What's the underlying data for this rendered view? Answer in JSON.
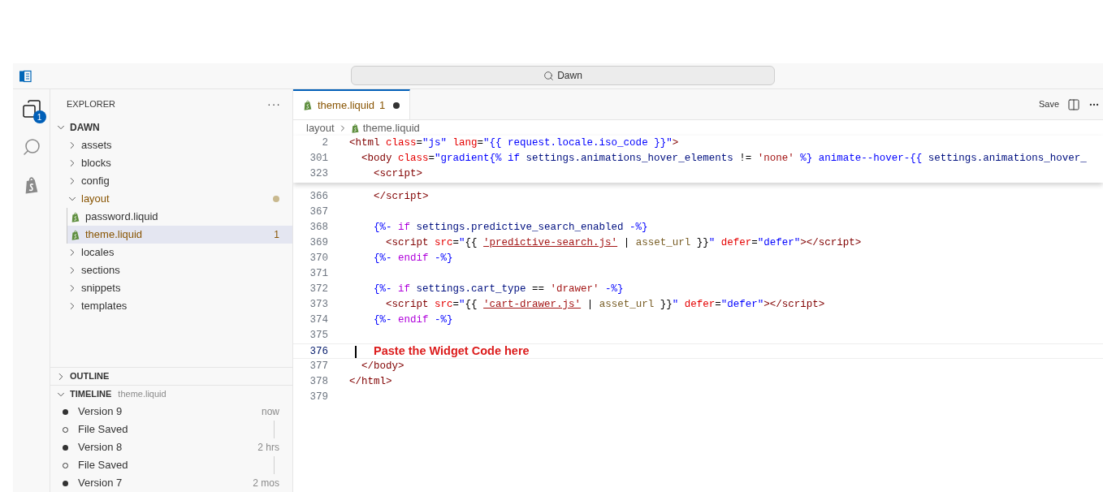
{
  "title_bar": {
    "search": "Dawn"
  },
  "activity_bar": [
    {
      "kind": "explorer",
      "badge": "1",
      "selected": true
    },
    {
      "kind": "search",
      "selected": false
    },
    {
      "kind": "shopify",
      "selected": false
    }
  ],
  "explorer": {
    "title": "EXPLORER",
    "more": "···",
    "root": {
      "label": "DAWN",
      "expanded": true,
      "children": [
        {
          "label": "assets",
          "folder": true,
          "expanded": false,
          "modified": false,
          "selected": false
        },
        {
          "label": "blocks",
          "folder": true,
          "expanded": false,
          "modified": false,
          "selected": false
        },
        {
          "label": "config",
          "folder": true,
          "expanded": false,
          "modified": false,
          "selected": false
        },
        {
          "label": "layout",
          "folder": true,
          "expanded": true,
          "modified": true,
          "selected": false,
          "children": [
            {
              "label": "password.liquid",
              "folder": false,
              "modified": false,
              "selected": false
            },
            {
              "label": "theme.liquid",
              "folder": false,
              "modified": true,
              "selected": true,
              "problems": "1"
            }
          ]
        },
        {
          "label": "locales",
          "folder": true,
          "expanded": false,
          "modified": false,
          "selected": false
        },
        {
          "label": "sections",
          "folder": true,
          "expanded": false,
          "modified": false,
          "selected": false
        },
        {
          "label": "snippets",
          "folder": true,
          "expanded": false,
          "modified": false,
          "selected": false
        },
        {
          "label": "templates",
          "folder": true,
          "expanded": false,
          "modified": false,
          "selected": false
        }
      ]
    }
  },
  "outline": {
    "label": "OUTLINE",
    "expanded": false
  },
  "timeline": {
    "label": "TIMELINE",
    "file": "theme.liquid",
    "expanded": true,
    "items": [
      {
        "kind": "version",
        "label": "Version 9",
        "time": "now"
      },
      {
        "kind": "saved",
        "label": "File Saved"
      },
      {
        "kind": "version",
        "label": "Version 8",
        "time": "2 hrs"
      },
      {
        "kind": "saved",
        "label": "File Saved"
      },
      {
        "kind": "version",
        "label": "Version 7",
        "time": "2 mos"
      }
    ]
  },
  "tabs": [
    {
      "label": "theme.liquid",
      "problems": "1",
      "dirty": true,
      "selected": true
    }
  ],
  "editor_actions": {
    "save": "Save"
  },
  "breadcrumb": [
    "layout",
    "theme.liquid"
  ],
  "sticky_lines": [
    {
      "number": "2",
      "tokens": [
        {
          "kind": "tag",
          "t": "<html"
        },
        {
          "kind": "attr",
          "t": " class"
        },
        {
          "kind": "plain",
          "t": "="
        },
        {
          "kind": "str",
          "t": "\"js\""
        },
        {
          "kind": "attr",
          "t": " lang"
        },
        {
          "kind": "plain",
          "t": "="
        },
        {
          "kind": "str",
          "t": "\"{{ request.locale.iso_code }}\""
        },
        {
          "kind": "tag",
          "t": ">"
        }
      ]
    },
    {
      "number": "301",
      "tokens": [
        {
          "kind": "tag",
          "t": "  <body"
        },
        {
          "kind": "attr",
          "t": " class"
        },
        {
          "kind": "plain",
          "t": "="
        },
        {
          "kind": "str",
          "t": "\"gradient"
        },
        {
          "kind": "delim",
          "t": "{%"
        },
        {
          "kind": "delim",
          "t": " if"
        },
        {
          "kind": "var",
          "t": " settings.animations_hover_elements"
        },
        {
          "kind": "plain",
          "t": " !="
        },
        {
          "kind": "lstr",
          "t": " 'none'"
        },
        {
          "kind": "delim",
          "t": " %}"
        },
        {
          "kind": "str",
          "t": " animate--hover-"
        },
        {
          "kind": "delim",
          "t": "{{"
        },
        {
          "kind": "var",
          "t": " settings.animations_hover_"
        }
      ]
    },
    {
      "number": "323",
      "tokens": [
        {
          "kind": "tag",
          "t": "    <script>"
        }
      ]
    }
  ],
  "lines": [
    {
      "number": "366",
      "current": false,
      "tokens": [
        {
          "kind": "tag",
          "t": "    </script>"
        }
      ]
    },
    {
      "number": "367",
      "current": false
    },
    {
      "number": "368",
      "current": false,
      "tokens": [
        {
          "kind": "delim",
          "t": "    {%-"
        },
        {
          "kind": "kw",
          "t": " if"
        },
        {
          "kind": "var",
          "t": " settings.predictive_search_enabled"
        },
        {
          "kind": "delim",
          "t": " -%}"
        }
      ]
    },
    {
      "number": "369",
      "current": false,
      "tokens": [
        {
          "kind": "tag",
          "t": "      <script"
        },
        {
          "kind": "attr",
          "t": " src"
        },
        {
          "kind": "plain",
          "t": "="
        },
        {
          "kind": "str",
          "t": "\""
        },
        {
          "kind": "plain",
          "t": "{{ "
        },
        {
          "kind": "link",
          "t": "'predictive-search.js'"
        },
        {
          "kind": "plain",
          "t": " |"
        },
        {
          "kind": "filter",
          "t": " asset_url"
        },
        {
          "kind": "plain",
          "t": " }}"
        },
        {
          "kind": "str",
          "t": "\""
        },
        {
          "kind": "attr",
          "t": " defer"
        },
        {
          "kind": "plain",
          "t": "="
        },
        {
          "kind": "str",
          "t": "\"defer\""
        },
        {
          "kind": "tag",
          "t": "></script>"
        }
      ]
    },
    {
      "number": "370",
      "current": false,
      "tokens": [
        {
          "kind": "delim",
          "t": "    {%-"
        },
        {
          "kind": "kw",
          "t": " endif"
        },
        {
          "kind": "delim",
          "t": " -%}"
        }
      ]
    },
    {
      "number": "371",
      "current": false
    },
    {
      "number": "372",
      "current": false,
      "tokens": [
        {
          "kind": "delim",
          "t": "    {%-"
        },
        {
          "kind": "kw",
          "t": " if"
        },
        {
          "kind": "var",
          "t": " settings.cart_type"
        },
        {
          "kind": "plain",
          "t": " =="
        },
        {
          "kind": "lstr",
          "t": " 'drawer'"
        },
        {
          "kind": "delim",
          "t": " -%}"
        }
      ]
    },
    {
      "number": "373",
      "current": false,
      "tokens": [
        {
          "kind": "tag",
          "t": "      <script"
        },
        {
          "kind": "attr",
          "t": " src"
        },
        {
          "kind": "plain",
          "t": "="
        },
        {
          "kind": "str",
          "t": "\""
        },
        {
          "kind": "plain",
          "t": "{{ "
        },
        {
          "kind": "link",
          "t": "'cart-drawer.js'"
        },
        {
          "kind": "plain",
          "t": " |"
        },
        {
          "kind": "filter",
          "t": " asset_url"
        },
        {
          "kind": "plain",
          "t": " }}"
        },
        {
          "kind": "str",
          "t": "\""
        },
        {
          "kind": "attr",
          "t": " defer"
        },
        {
          "kind": "plain",
          "t": "="
        },
        {
          "kind": "str",
          "t": "\"defer\""
        },
        {
          "kind": "tag",
          "t": "></script>"
        }
      ]
    },
    {
      "number": "374",
      "current": false,
      "tokens": [
        {
          "kind": "delim",
          "t": "    {%-"
        },
        {
          "kind": "kw",
          "t": " endif"
        },
        {
          "kind": "delim",
          "t": " -%}"
        }
      ]
    },
    {
      "number": "375",
      "current": false
    },
    {
      "number": "376",
      "current": true,
      "note": "Paste the Widget Code here"
    },
    {
      "number": "377",
      "current": false,
      "tokens": [
        {
          "kind": "tag",
          "t": "  </body>"
        }
      ]
    },
    {
      "number": "378",
      "current": false,
      "tokens": [
        {
          "kind": "tag",
          "t": "</html>"
        }
      ]
    },
    {
      "number": "379",
      "current": false
    }
  ]
}
